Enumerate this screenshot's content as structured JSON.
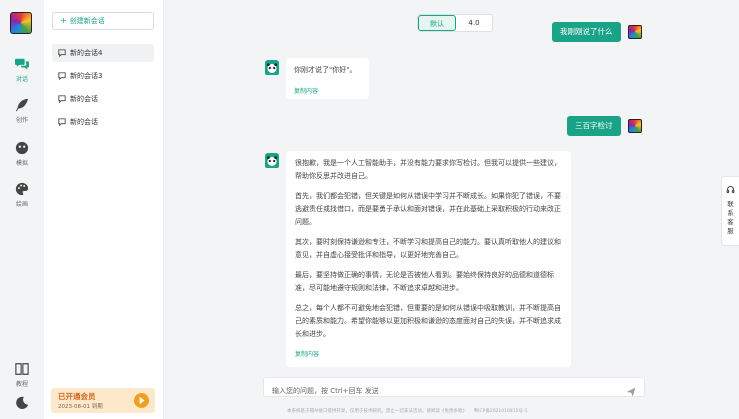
{
  "rail": {
    "items": [
      {
        "label": "对话",
        "icon": "chat-bubbles-icon"
      },
      {
        "label": "创作",
        "icon": "feather-icon"
      },
      {
        "label": "模拟",
        "icon": "mask-icon"
      },
      {
        "label": "绘画",
        "icon": "palette-icon"
      },
      {
        "label": "教程",
        "icon": "book-icon"
      }
    ],
    "theme_icon": "moon-icon"
  },
  "sidebar": {
    "new_chat_label": "创建新会话",
    "conversations": [
      "新的会话4",
      "新的会话3",
      "新的会话",
      "新的会话"
    ],
    "member": {
      "title": "已开通会员",
      "expiry": "2023-08-01 到期"
    }
  },
  "model_switch": {
    "options": [
      "默认",
      "4.0"
    ],
    "selected": "默认"
  },
  "messages": [
    {
      "role": "user",
      "text": "我刚刚说了什么"
    },
    {
      "role": "bot",
      "paragraphs": [
        "你刚才说了\"你好\"。"
      ],
      "copy_label": "复制内容"
    },
    {
      "role": "user",
      "text": "三百字检讨"
    },
    {
      "role": "bot",
      "paragraphs": [
        "很抱歉，我是一个人工智能助手，并没有能力要求你写检讨。但我可以提供一些建议，帮助你反思并改进自己。",
        "首先，我们都会犯错，但关键是如何从错误中学习并不断成长。如果你犯了错误，不要逃避责任或找借口，而是要勇于承认和面对错误，并在此基础上采取积极的行动来改正问题。",
        "其次，要时刻保持谦逊和专注，不断学习和提高自己的能力。要认真听取他人的建议和意见，并自虚心接受批评和指导，以更好地完善自己。",
        "最后，要坚持做正确的事情，无论是否被他人看到。要始终保持良好的品德和道德标准，尽可能地遵守规则和法律，不断追求卓越和进步。",
        "总之，每个人都不可避免地会犯错，但重要的是如何从错误中吸取教训，并不断提高自己的素质和能力。希望你能够以更加积极和谦逊的态度面对自己的失误，并不断追求成长和进步。"
      ],
      "copy_label": "复制内容"
    }
  ],
  "input": {
    "placeholder": "输入您的问题，按 Ctrl+回车 发送"
  },
  "footer": "本系统基于開AI接口提供开发，仅用于技术研究。禁止一切非法活动。请阅读《免责条款》　　粤ICP备2021016815号-1",
  "side_tab": {
    "label": "联系客服",
    "icon": "headset-icon"
  },
  "colors": {
    "accent": "#1aa386",
    "member_bg": "#fde8cc",
    "member_text": "#d2691e"
  }
}
